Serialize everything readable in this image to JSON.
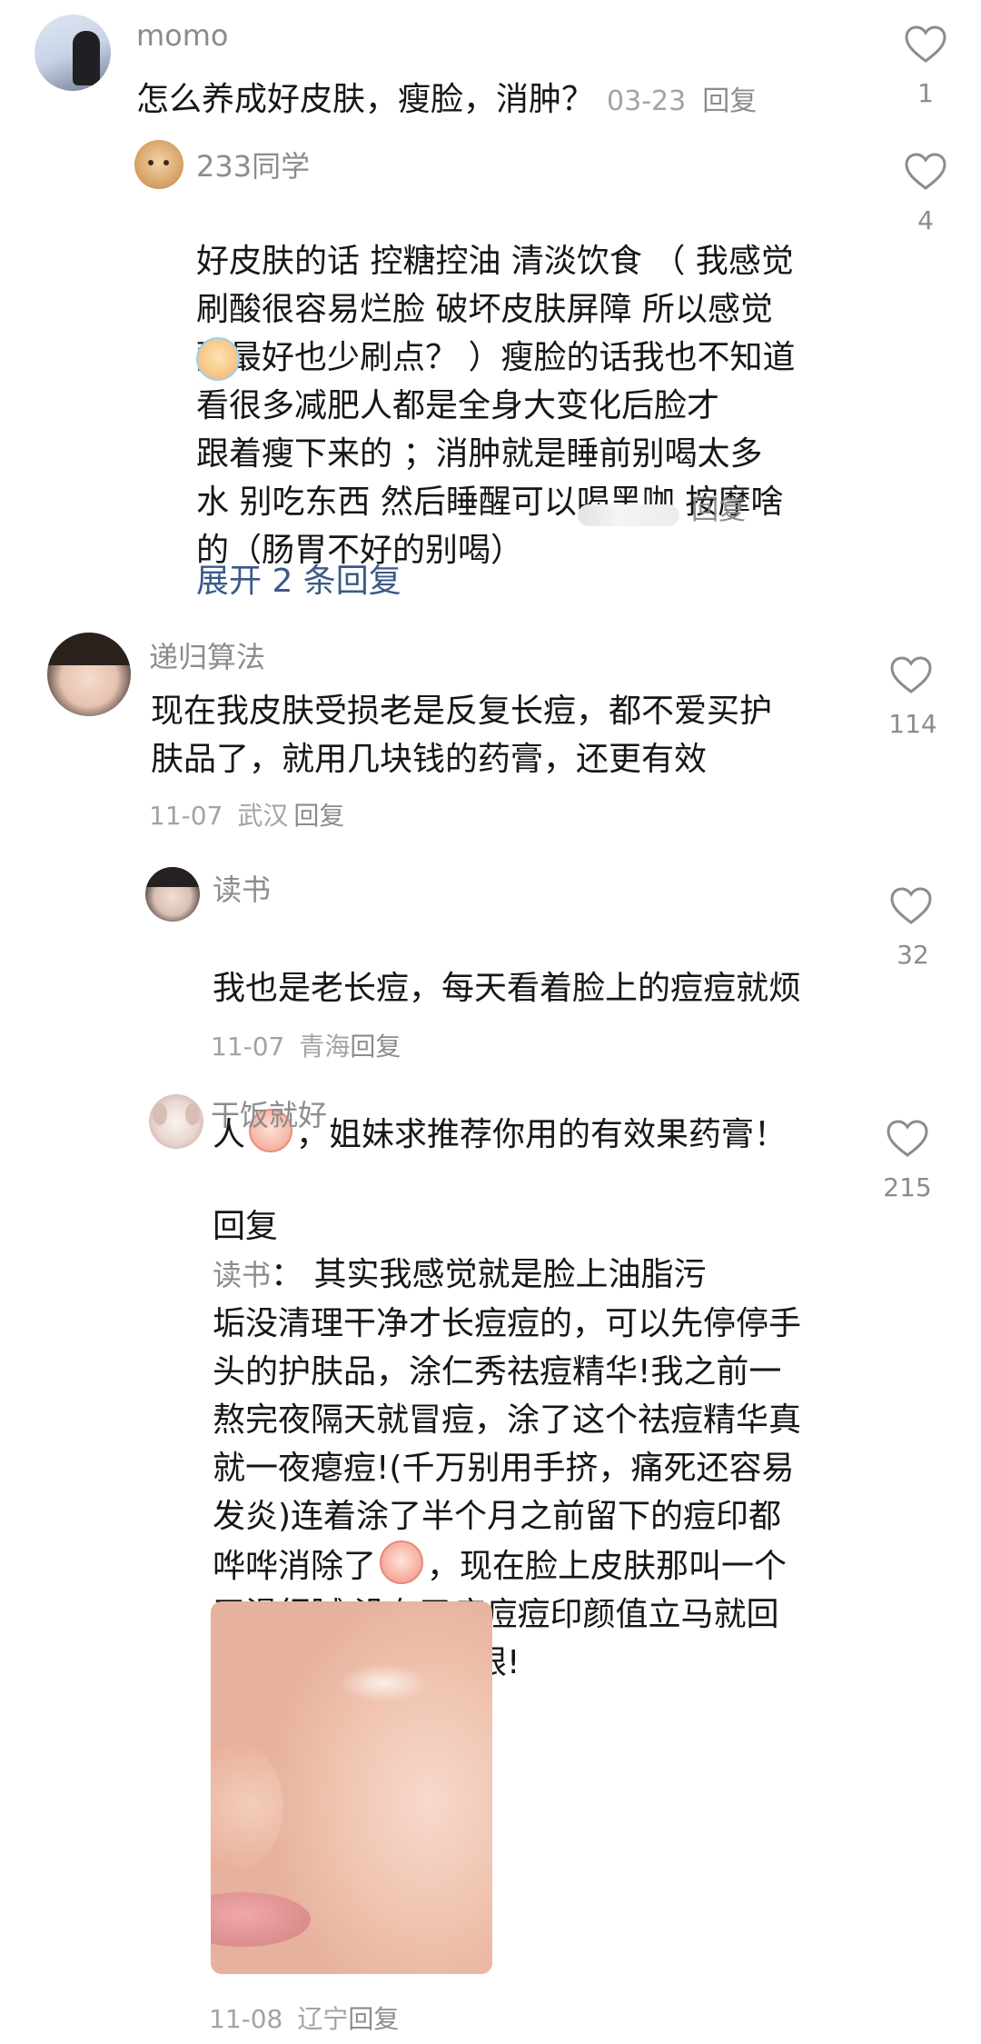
{
  "comments": [
    {
      "user": "momo",
      "text": "怎么养成好皮肤，瘦脸，消肿？",
      "date": "03-23",
      "reply": "回复",
      "likes": "1",
      "avatar_icon": "avatar-momo",
      "replies": [
        {
          "user": "233同学",
          "text": "好皮肤的话 控糖控油 清淡饮食 （ 我感觉\n刷酸很容易烂脸 破坏皮肤屏障 所以感觉\n酸最好也少刷点？ ）瘦脸的话我也不知道\n看很多减肥人都是全身大变化后脸才\n跟着瘦下来的 ；消肿就是睡前别喝太多\n水 别吃东西 然后睡醒可以喝黑咖 按摩啥\n的（肠胃不好的别喝）",
          "reply": "回复",
          "likes": "4",
          "emoji_icon": "crying-face-icon",
          "avatar_icon": "avatar-cat"
        }
      ],
      "expand_label": "展开 2 条回复"
    },
    {
      "user": "递归算法",
      "text": "现在我皮肤受损老是反复长痘，都不爱买护\n肤品了，就用几块钱的药膏，还更有效",
      "date": "11-07",
      "location": "武汉",
      "reply": "回复",
      "likes": "114",
      "avatar_icon": "avatar-girl",
      "replies": [
        {
          "user": "读书",
          "text_a": "我也是老长痘，每天看着脸上的痘痘就烦",
          "text_b": "人",
          "text_c": "，姐妹求推荐你用的有效果药膏！",
          "date": "11-07",
          "location": "青海",
          "reply": "回复",
          "likes": "32",
          "emoji_icon": "upset-face-icon",
          "avatar_icon": "avatar-portrait"
        },
        {
          "user": "干饭就好",
          "reply_prefix": "回复",
          "reply_to": "读书",
          "reply_colon": "：",
          "text_a": " 其实我感觉就是脸上油脂污\n垢没清理干净才长痘痘的，可以先停停手\n头的护肤品，涂仁秀祛痘精华!我之前一\n熬完夜隔天就冒痘，涂了这个祛痘精华真\n就一夜瘪痘!(千万别用手挤，痛死还容易\n发炎)连着涂了半个月之前留下的痘印都\n哗哗消除了",
          "text_b": "，现在脸上皮肤那叫一个\n平滑细腻,没有了痘痘痘印颜值立马就回\n春，怎么看怎么顺眼!",
          "date": "11-08",
          "location": "辽宁",
          "reply": "回复",
          "likes": "215",
          "emoji_icon": "peach-face-icon",
          "avatar_icon": "avatar-puppy"
        }
      ]
    }
  ],
  "colors": {
    "text": "#161616",
    "muted": "#8c8c8c",
    "link": "#3a5a88"
  }
}
